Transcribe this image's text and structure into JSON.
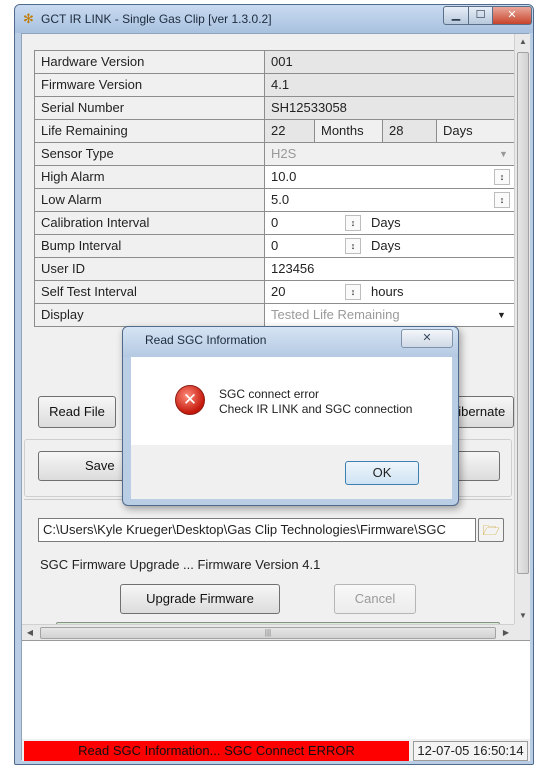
{
  "window": {
    "title": "GCT IR LINK - Single Gas Clip [ver 1.3.0.2]",
    "min_glyph": "▁",
    "max_glyph": "☐",
    "close_glyph": "✕"
  },
  "grid": {
    "hardware_version": {
      "label": "Hardware Version",
      "value": "001"
    },
    "firmware_version": {
      "label": "Firmware Version",
      "value": "4.1"
    },
    "serial_number": {
      "label": "Serial Number",
      "value": "SH12533058"
    },
    "life_remaining": {
      "label": "Life Remaining",
      "months": "22",
      "months_unit": "Months",
      "days": "28",
      "days_unit": "Days"
    },
    "sensor_type": {
      "label": "Sensor Type",
      "value": "H2S"
    },
    "high_alarm": {
      "label": "High Alarm",
      "value": "10.0"
    },
    "low_alarm": {
      "label": "Low Alarm",
      "value": "5.0"
    },
    "calibration_interval": {
      "label": "Calibration Interval",
      "value": "0",
      "unit": "Days"
    },
    "bump_interval": {
      "label": "Bump Interval",
      "value": "0",
      "unit": "Days"
    },
    "user_id": {
      "label": "User ID",
      "value": "123456"
    },
    "self_test_interval": {
      "label": "Self Test Interval",
      "value": "20",
      "unit": "hours"
    },
    "display": {
      "label": "Display",
      "value": "Tested Life Remaining"
    }
  },
  "buttons": {
    "read_file": "Read File",
    "hibernate": "Hibernate",
    "save": "Save",
    "upgrade_firmware": "Upgrade Firmware",
    "cancel": "Cancel"
  },
  "firmware": {
    "path": "C:\\Users\\Kyle Krueger\\Desktop\\Gas Clip Technologies\\Firmware\\SGC",
    "status": "SGC Firmware Upgrade ... Firmware Version 4.1"
  },
  "status_bar": {
    "message": "Read SGC Information... SGC Connect ERROR",
    "timestamp": "12-07-05 16:50:14"
  },
  "dialog": {
    "title": "Read SGC Information",
    "line1": "SGC connect error",
    "line2": "Check IR LINK and SGC connection",
    "ok": "OK"
  },
  "colors": {
    "status_error": "#ff0000",
    "titlebar": "#b9cde4"
  }
}
